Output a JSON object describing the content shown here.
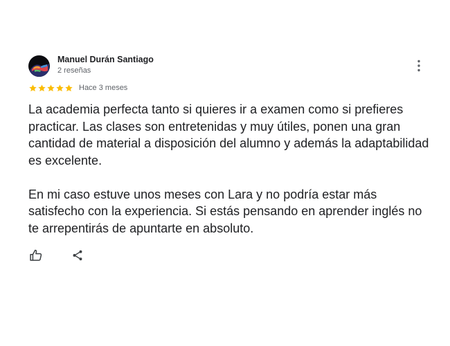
{
  "review": {
    "author": {
      "name": "Manuel Durán Santiago",
      "reviews_count": "2 reseñas",
      "avatar_icon": "avatar-icon"
    },
    "rating": {
      "stars": 5,
      "max_stars": 5,
      "star_color": "#fbbc04"
    },
    "time_ago": "Hace 3 meses",
    "paragraphs": [
      "La academia perfecta tanto si quieres ir a examen como si prefieres practicar. Las clases son entretenidas y muy útiles, ponen una gran cantidad de material a disposición del alumno y además la adaptabilidad es excelente.",
      "En mi caso estuve unos meses con Lara y no podría estar más satisfecho con la experiencia. Si estás pensando en aprender inglés no te arrepentirás de apuntarte en absoluto."
    ],
    "actions": {
      "like_icon": "thumb-up-icon",
      "share_icon": "share-icon",
      "more_icon": "more-vert-icon"
    }
  }
}
